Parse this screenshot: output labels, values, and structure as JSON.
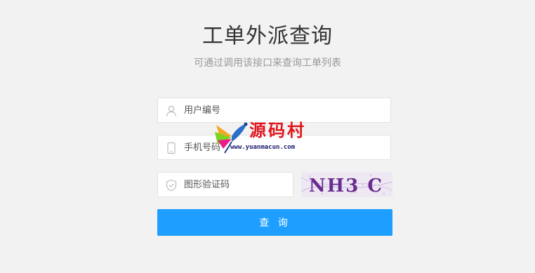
{
  "page": {
    "title": "工单外派查询",
    "subtitle": "可通过调用该接口来查询工单列表"
  },
  "form": {
    "userid": {
      "placeholder": "用户编号",
      "icon": "user-icon"
    },
    "phone": {
      "placeholder": "手机号码",
      "icon": "phone-icon"
    },
    "captcha": {
      "placeholder": "图形验证码",
      "icon": "shield-icon",
      "image_text": "NH3 C"
    },
    "submit_label": "查 询"
  },
  "watermark": {
    "text": "源码村",
    "url": "www.yuanmacun.com"
  },
  "colors": {
    "background": "#f2f2f2",
    "primary": "#1e9fff",
    "watermark_red": "#e0161d"
  }
}
